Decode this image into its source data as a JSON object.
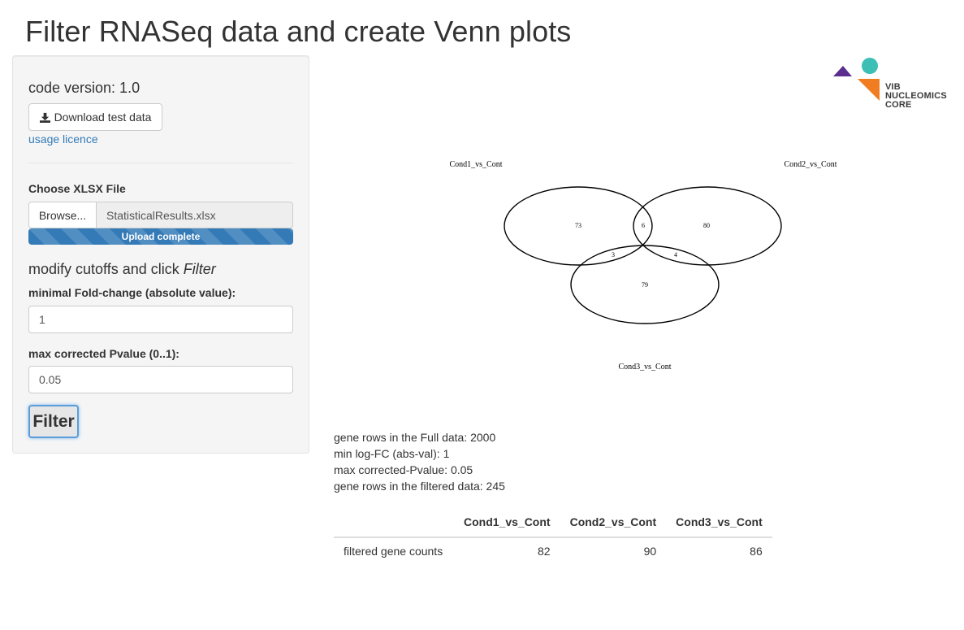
{
  "page": {
    "title": "Filter RNASeq data and create Venn plots"
  },
  "sidebar": {
    "version": "code version: 1.0",
    "download_label": "Download test data",
    "download_icon": "download-icon",
    "licence_link": "usage licence",
    "file_label": "Choose XLSX File",
    "browse_label": "Browse...",
    "file_name": "StatisticalResults.xlsx",
    "upload_status": "Upload complete",
    "upload_progress_pct": 100,
    "cutoff_heading_prefix": "modify cutoffs and click",
    "cutoff_heading_em": "Filter",
    "fc_label": "minimal Fold-change (absolute value):",
    "fc_value": "1",
    "pv_label": "max corrected Pvalue (0..1):",
    "pv_value": "0.05",
    "filter_label": "Filter"
  },
  "logo": {
    "line1": "VIB",
    "line2": "NUCLEOMICS",
    "line3": "CORE",
    "colors": {
      "purple": "#5b2d8e",
      "teal": "#3dbfb5",
      "orange": "#f07d22"
    }
  },
  "venn": {
    "sets": [
      "Cond1_vs_Cont",
      "Cond2_vs_Cont",
      "Cond3_vs_Cont"
    ],
    "regions": {
      "only_1": "73",
      "only_2": "80",
      "only_3": "79",
      "1_and_2": "6",
      "1_and_3": "3",
      "2_and_3": "4"
    }
  },
  "summary": {
    "full_rows": "gene rows in the Full data: 2000",
    "min_fc": "min log-FC (abs-val): 1",
    "max_pv": "max corrected-Pvalue: 0.05",
    "filtered_rows": "gene rows in the filtered data: 245"
  },
  "table": {
    "headers": [
      "",
      "Cond1_vs_Cont",
      "Cond2_vs_Cont",
      "Cond3_vs_Cont"
    ],
    "rows": [
      {
        "label": "filtered gene counts",
        "values": [
          "82",
          "90",
          "86"
        ]
      }
    ]
  }
}
